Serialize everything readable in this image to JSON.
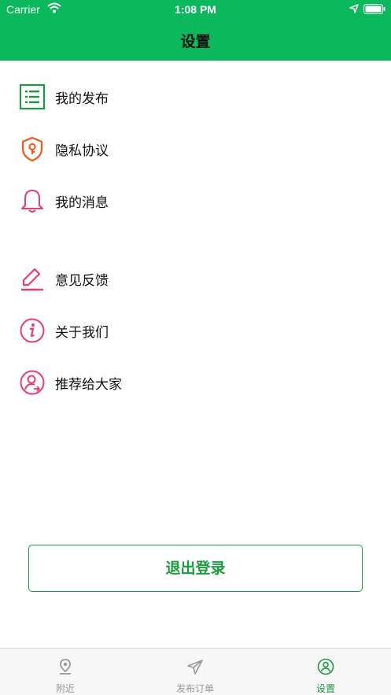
{
  "status_bar": {
    "carrier": "Carrier",
    "time": "1:08 PM"
  },
  "header": {
    "title": "设置"
  },
  "menu": {
    "items": [
      {
        "label": "我的发布",
        "icon": "list-icon",
        "color": "#1b9a3f"
      },
      {
        "label": "隐私协议",
        "icon": "shield-lock-icon",
        "color": "#f2541b"
      },
      {
        "label": "我的消息",
        "icon": "bell-icon",
        "color": "#e83e6f"
      },
      {
        "label": "意见反馈",
        "icon": "pencil-icon",
        "color": "#e83e6f"
      },
      {
        "label": "关于我们",
        "icon": "info-icon",
        "color": "#e83e6f"
      },
      {
        "label": "推荐给大家",
        "icon": "user-share-icon",
        "color": "#e83e6f"
      }
    ]
  },
  "logout_label": "退出登录",
  "tabs": [
    {
      "label": "附近",
      "icon": "location-pin-icon",
      "active": false
    },
    {
      "label": "发布订单",
      "icon": "paper-plane-icon",
      "active": false
    },
    {
      "label": "设置",
      "icon": "user-circle-icon",
      "active": true
    }
  ],
  "colors": {
    "brand_green": "#0cb85c",
    "accent_green": "#1b9a3f",
    "inactive_gray": "#999999"
  }
}
